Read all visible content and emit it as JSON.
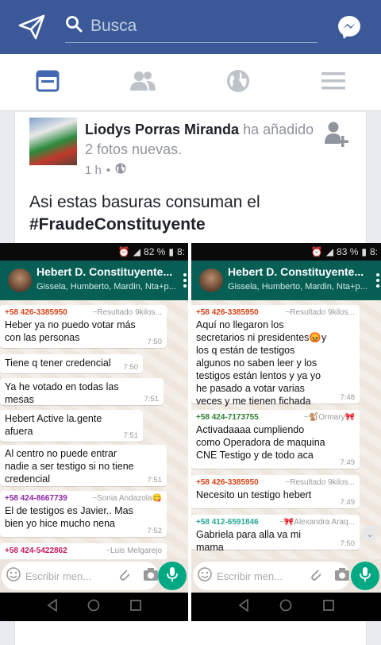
{
  "search": {
    "placeholder": "Busca"
  },
  "post": {
    "author": "Liodys Porras Miranda",
    "action": " ha añadido 2 fotos nuevas.",
    "time": "1 h",
    "text": "Asi estas basuras consuman el",
    "hashtag": "#FraudeConstituyente"
  },
  "photos": [
    {
      "status": "82 %",
      "status_extra": "8:",
      "chat_title": "Hebert D. Constituyente...",
      "chat_subtitle": "Gissela, Humberto, Mardin, Nta+p...",
      "input_placeholder": "Escribir men...",
      "messages": [
        {
          "phone": "+58 426-3385950",
          "alias": "~Resultado 9kilos...",
          "text": "Heber ya no puedo votar más con las personas",
          "time": "7:50",
          "phone_color": "#d84315"
        },
        {
          "phone": "",
          "alias": "",
          "text": "Tiene q tener credencial",
          "time": "7:50",
          "phone_color": ""
        },
        {
          "phone": "",
          "alias": "",
          "text": "Ya he votado en todas las mesas",
          "time": "7:51",
          "phone_color": ""
        },
        {
          "phone": "",
          "alias": "",
          "text": "Hebert Active la.gente afuera",
          "time": "7:51",
          "phone_color": ""
        },
        {
          "phone": "",
          "alias": "",
          "text": "Al centro no puede entrar nadie a ser testigo si no tiene credencial",
          "time": "7:51",
          "phone_color": ""
        },
        {
          "phone": "+58 424-8667739",
          "alias": "~Sonia Andazola😋",
          "text": "El de testigos es Javier.. Mas bien yo hice mucho nena",
          "time": "7:52",
          "phone_color": "#8e24aa"
        },
        {
          "phone": "+58 424-5422862",
          "alias": "~Luis Melgarejo",
          "text": "",
          "time": "",
          "phone_color": "#c2185b"
        }
      ]
    },
    {
      "status": "83 %",
      "status_extra": "8:",
      "chat_title": "Hebert D. Constituyente...",
      "chat_subtitle": "Gissela, Humberto, Mardin, Nta+p...",
      "input_placeholder": "Escribir men...",
      "messages": [
        {
          "phone": "+58 426-3385950",
          "alias": "~Resultado 9kilos...",
          "text": "Aquí no llegaron los secretarios ni presidentes😡y los q están de testigos algunos no saben leer y los testigos están lentos y ya yo he pasado a votar varias veces y me tienen fichada",
          "time": "7:48",
          "phone_color": "#d84315"
        },
        {
          "phone": "+58 424-7173755",
          "alias": "~🐒Ormary🎀",
          "text": "Activadaaaa cumpliendo como Operadora de maquina CNE Testigo y de todo aca",
          "time": "7:49",
          "phone_color": "#2e7d32"
        },
        {
          "phone": "+58 426-3385950",
          "alias": "~Resultado 9kilos...",
          "text": "Necesito un testigo hebert",
          "time": "7:49",
          "phone_color": "#d84315"
        },
        {
          "phone": "+58 412-6591846",
          "alias": "~🎀Alexandra Araq...",
          "text": "Gabriela para alla va mi mama",
          "time": "7:50",
          "phone_color": "#26a69a"
        }
      ]
    }
  ]
}
